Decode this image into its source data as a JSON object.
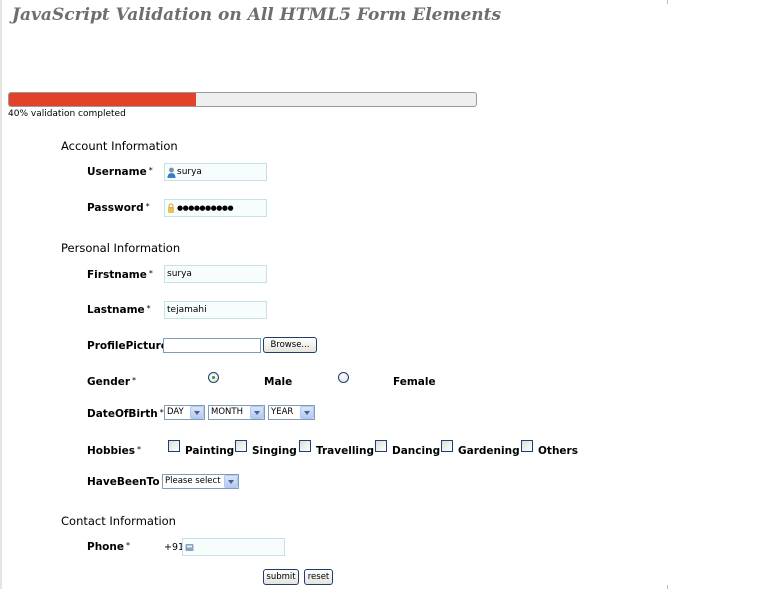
{
  "page": {
    "title": "JavaScript Validation on All HTML5 Form Elements"
  },
  "progress": {
    "fraction": 0.4,
    "text": "40% validation completed",
    "fill_color": "#e2412a"
  },
  "sections": {
    "account": "Account Information",
    "personal": "Personal Information",
    "contact": "Contact Information"
  },
  "required_mark": "*",
  "fields": {
    "username": {
      "label": "Username",
      "value": "surya",
      "icon": "user-icon"
    },
    "password": {
      "label": "Password",
      "masked_value": "●●●●●●●●●●",
      "icon": "key-icon"
    },
    "firstname": {
      "label": "Firstname",
      "value": "surya"
    },
    "lastname": {
      "label": "Lastname",
      "value": "tejamahi"
    },
    "profile_picture": {
      "label": "ProfilePicture",
      "browse_label": "Browse..."
    },
    "gender": {
      "label": "Gender",
      "options": [
        {
          "label": "Male",
          "checked": true
        },
        {
          "label": "Female",
          "checked": false
        }
      ]
    },
    "dob": {
      "label": "DateOfBirth",
      "day": "DAY",
      "month": "MONTH",
      "year": "YEAR"
    },
    "hobbies": {
      "label": "Hobbies",
      "options": [
        "Painting",
        "Singing",
        "Travelling",
        "Dancing",
        "Gardening",
        "Others"
      ]
    },
    "have_been_to": {
      "label": "HaveBeenTo",
      "selected": "Please select"
    },
    "phone": {
      "label": "Phone",
      "prefix": "+91",
      "value": "",
      "icon": "phone-icon"
    }
  },
  "buttons": {
    "submit": "submit",
    "reset": "reset"
  }
}
